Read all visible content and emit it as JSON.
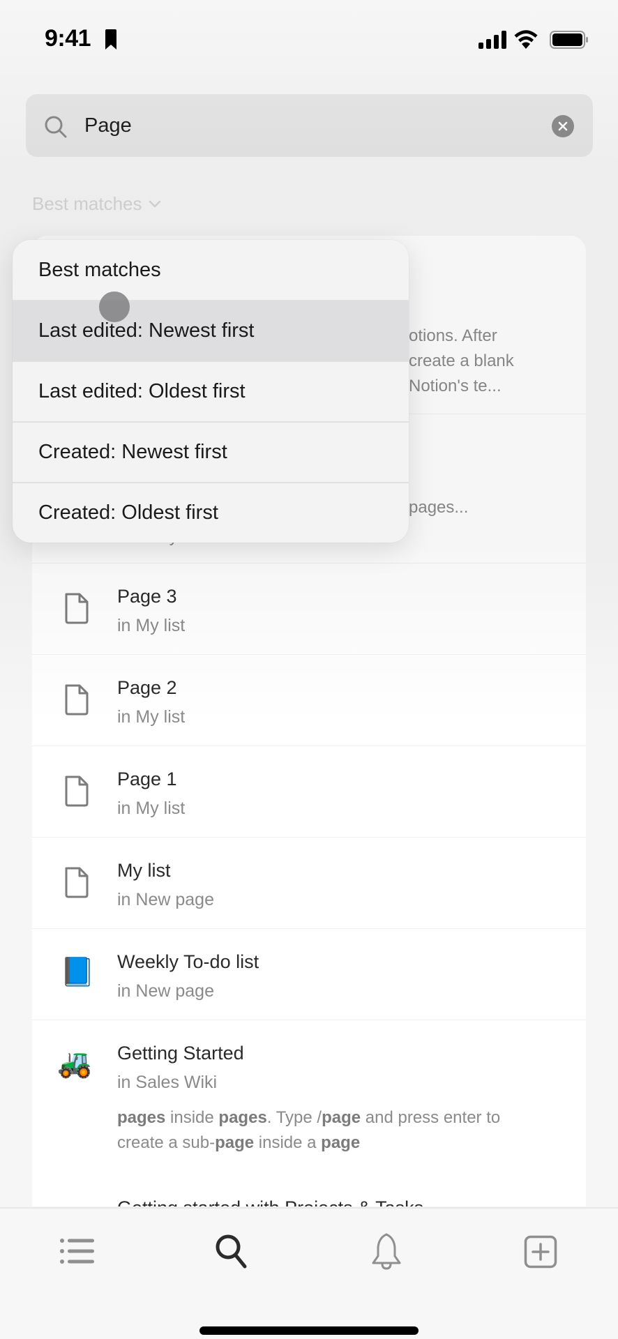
{
  "status_bar": {
    "time": "9:41",
    "icons": [
      "bookmark-icon",
      "cellular-signal-icon",
      "wifi-icon",
      "battery-icon"
    ]
  },
  "search": {
    "value": "Page",
    "placeholder": "Search",
    "clear_label": "Clear search"
  },
  "sort": {
    "current": "Best matches",
    "menu_items": [
      {
        "label": "Best matches"
      },
      {
        "label": "Last edited: Newest first",
        "pressed": true
      },
      {
        "label": "Last edited: Oldest first"
      },
      {
        "label": "Created: Newest first"
      },
      {
        "label": "Created: Oldest first"
      }
    ]
  },
  "results": {
    "hidden_snippets": {
      "first": [
        "otions. After",
        "create a blank",
        "Notion's te..."
      ],
      "second": [
        "pages..."
      ],
      "second_cut": "infinitely."
    },
    "items": [
      {
        "title": "Page 3",
        "parent": "in My list",
        "icon": "page-icon"
      },
      {
        "title": "Page 2",
        "parent": "in My list",
        "icon": "page-icon"
      },
      {
        "title": "Page 1",
        "parent": "in My list",
        "icon": "page-icon"
      },
      {
        "title": "My list",
        "parent": "in New page",
        "icon": "page-icon"
      },
      {
        "title": "Weekly To-do list",
        "parent": "in New page",
        "icon": "blue-book-icon",
        "emoji": "📘"
      },
      {
        "title": "Getting Started",
        "parent": "in Sales Wiki",
        "icon": "tractor-icon",
        "emoji": "🚜",
        "snippet_parts": [
          {
            "text": "pages",
            "bold": true
          },
          {
            "text": " inside ",
            "bold": false
          },
          {
            "text": "pages",
            "bold": true
          },
          {
            "text": ". Type /",
            "bold": false
          },
          {
            "text": "page",
            "bold": true
          },
          {
            "text": " and press enter to create a sub-",
            "bold": false
          },
          {
            "text": "page",
            "bold": true
          },
          {
            "text": " inside a ",
            "bold": false
          },
          {
            "text": "page",
            "bold": true
          }
        ]
      },
      {
        "title": "Getting started with Projects & Tasks",
        "parent": "",
        "icon": ""
      }
    ]
  },
  "tab_bar": {
    "tabs": [
      {
        "name": "home",
        "icon": "list-icon",
        "active": false
      },
      {
        "name": "search",
        "icon": "search-icon",
        "active": true
      },
      {
        "name": "inbox",
        "icon": "bell-icon",
        "active": false
      },
      {
        "name": "new-page",
        "icon": "new-page-icon",
        "active": false
      }
    ]
  },
  "colors": {
    "background": "#f7f6f7",
    "search_field": "#e7e6e7",
    "menu_background": "#f4f3f4",
    "menu_pressed": "#dedddf",
    "text_primary": "#1f1f1f",
    "text_secondary": "#8a8a8a"
  }
}
